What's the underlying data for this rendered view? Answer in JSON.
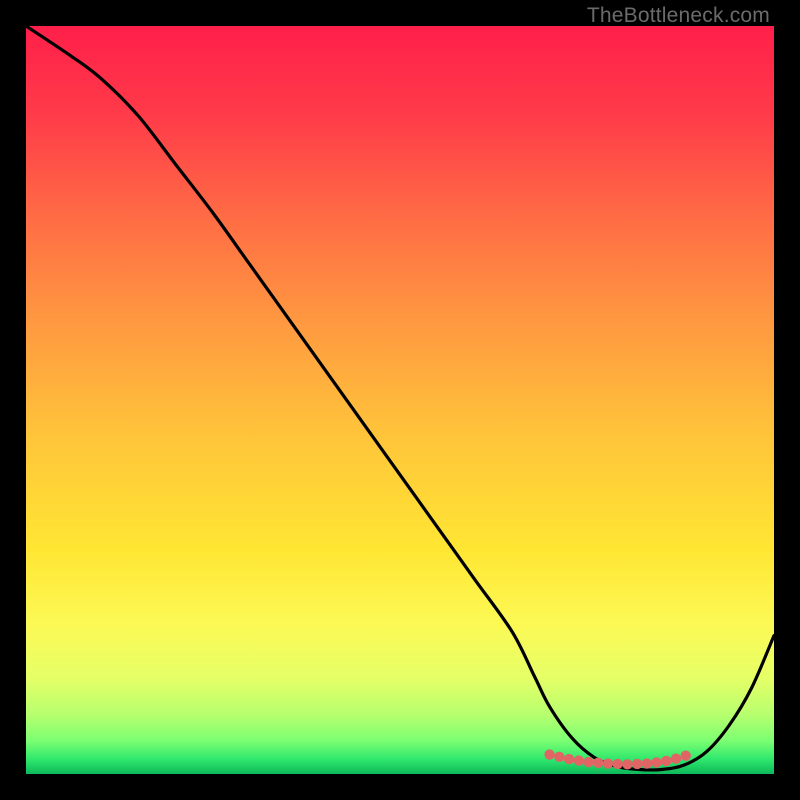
{
  "watermark": "TheBottleneck.com",
  "chart_data": {
    "type": "line",
    "title": "",
    "xlabel": "",
    "ylabel": "",
    "xlim": [
      0,
      100
    ],
    "ylim": [
      0,
      100
    ],
    "series": [
      {
        "name": "curve",
        "x": [
          0,
          6,
          10,
          15,
          20,
          25,
          30,
          35,
          40,
          45,
          50,
          55,
          60,
          65,
          68,
          70,
          73,
          76,
          79,
          82,
          85,
          88,
          91,
          94,
          97,
          100
        ],
        "y": [
          100,
          96,
          93,
          88,
          81.5,
          75,
          68,
          61,
          54,
          47,
          40,
          33,
          26,
          19,
          13,
          9,
          4.8,
          2.2,
          1.0,
          0.6,
          0.6,
          1.2,
          3.0,
          6.5,
          11.5,
          18.5
        ]
      },
      {
        "name": "highlight-dots",
        "x": [
          70.0,
          71.3,
          72.6,
          73.9,
          75.2,
          76.5,
          77.8,
          79.1,
          80.4,
          81.7,
          83.0,
          84.3,
          85.6,
          86.9,
          88.2
        ],
        "y": [
          2.6,
          2.3,
          2.0,
          1.8,
          1.6,
          1.5,
          1.4,
          1.35,
          1.3,
          1.35,
          1.4,
          1.55,
          1.75,
          2.05,
          2.45
        ]
      }
    ],
    "gradient_stops": [
      {
        "offset": 0.0,
        "color": "#ff1f4a"
      },
      {
        "offset": 0.12,
        "color": "#ff3b49"
      },
      {
        "offset": 0.25,
        "color": "#ff6a45"
      },
      {
        "offset": 0.4,
        "color": "#ff9a40"
      },
      {
        "offset": 0.55,
        "color": "#ffc53a"
      },
      {
        "offset": 0.7,
        "color": "#ffe633"
      },
      {
        "offset": 0.8,
        "color": "#fcf955"
      },
      {
        "offset": 0.87,
        "color": "#e6ff66"
      },
      {
        "offset": 0.92,
        "color": "#b8ff6e"
      },
      {
        "offset": 0.955,
        "color": "#7dff72"
      },
      {
        "offset": 0.98,
        "color": "#30e86e"
      },
      {
        "offset": 1.0,
        "color": "#0db85a"
      }
    ]
  }
}
